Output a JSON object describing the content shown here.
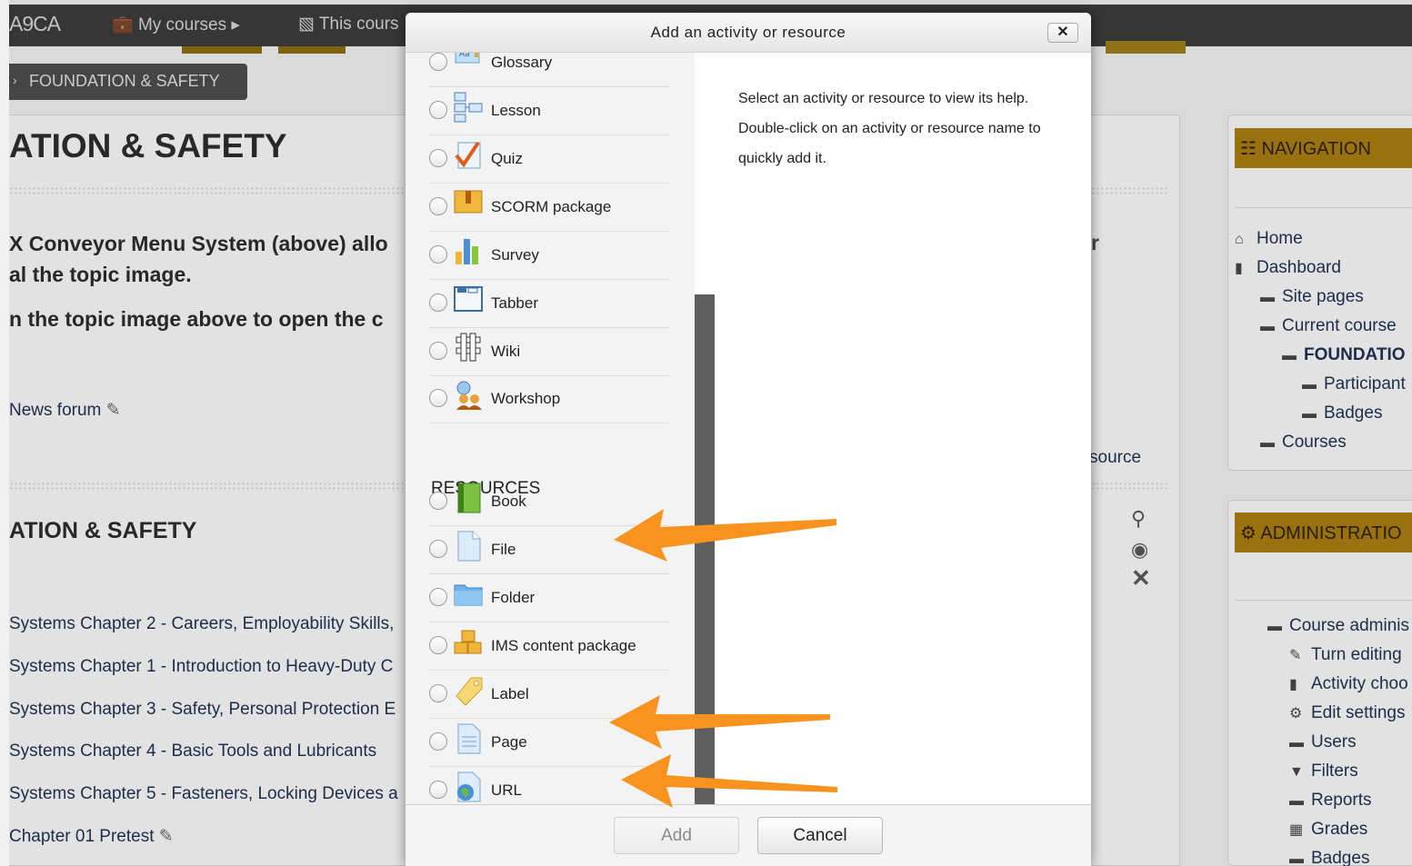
{
  "topbar": {
    "brand": "A9CA",
    "my_courses": "My courses",
    "this_course": "This cours"
  },
  "breadcrumb": {
    "label": "FOUNDATION & SAFETY"
  },
  "background": {
    "title1": "ATION & SAFETY",
    "para1": "X Conveyor Menu System (above) allo",
    "para2": "al the topic image.",
    "para3": "n the topic image above to open the c",
    "news_forum": "News forum",
    "stray_r": "r",
    "source_text": "source",
    "title2": "ATION & SAFETY",
    "links": [
      "Systems Chapter 2 - Careers, Employability Skills,",
      "Systems Chapter 1 - Introduction to Heavy-Duty C",
      "Systems Chapter 3 - Safety, Personal Protection E",
      "Systems Chapter 4 - Basic Tools and Lubricants",
      "Systems Chapter 5 - Fasteners, Locking Devices a",
      "Chapter 01 Pretest"
    ]
  },
  "navigation_block": {
    "title": "NAVIGATION",
    "items": [
      {
        "label": "Home",
        "icon": "home-icon"
      },
      {
        "label": "Dashboard",
        "icon": "file-icon"
      },
      {
        "label": "Site pages",
        "icon": "folder-icon"
      },
      {
        "label": "Current course",
        "icon": "folder-open-icon"
      },
      {
        "label": "FOUNDATIO",
        "icon": "folder-open-icon"
      },
      {
        "label": "Participant",
        "icon": "folder-icon"
      },
      {
        "label": "Badges",
        "icon": "folder-icon"
      },
      {
        "label": "Courses",
        "icon": "folder-icon"
      }
    ]
  },
  "administration_block": {
    "title": "ADMINISTRATIO",
    "items": [
      {
        "label": "Course adminis",
        "icon": "folder-open-icon"
      },
      {
        "label": "Turn editing",
        "icon": "pencil-icon"
      },
      {
        "label": "Activity choo",
        "icon": "file-icon"
      },
      {
        "label": "Edit settings",
        "icon": "gears-icon"
      },
      {
        "label": "Users",
        "icon": "folder-icon"
      },
      {
        "label": "Filters",
        "icon": "filter-icon"
      },
      {
        "label": "Reports",
        "icon": "folder-icon"
      },
      {
        "label": "Grades",
        "icon": "table-icon"
      },
      {
        "label": "Badges",
        "icon": "folder-icon"
      }
    ]
  },
  "dialog": {
    "title": "Add an activity or resource",
    "close": "✕",
    "activities": [
      {
        "label": "Glossary",
        "icon": "glossary-icon"
      },
      {
        "label": "Lesson",
        "icon": "lesson-icon"
      },
      {
        "label": "Quiz",
        "icon": "quiz-icon"
      },
      {
        "label": "SCORM package",
        "icon": "scorm-icon"
      },
      {
        "label": "Survey",
        "icon": "survey-icon"
      },
      {
        "label": "Tabber",
        "icon": "tabber-icon"
      },
      {
        "label": "Wiki",
        "icon": "wiki-icon"
      },
      {
        "label": "Workshop",
        "icon": "workshop-icon"
      }
    ],
    "resources_heading": "RESOURCES",
    "resources": [
      {
        "label": "Book",
        "icon": "book-icon"
      },
      {
        "label": "File",
        "icon": "file-icon"
      },
      {
        "label": "Folder",
        "icon": "folder-icon"
      },
      {
        "label": "IMS content package",
        "icon": "ims-package-icon"
      },
      {
        "label": "Label",
        "icon": "label-icon"
      },
      {
        "label": "Page",
        "icon": "page-icon"
      },
      {
        "label": "URL",
        "icon": "url-icon"
      }
    ],
    "help_text": "Select an activity or resource to view its help. Double-click on an activity or resource name to quickly add it.",
    "add_button": "Add",
    "cancel_button": "Cancel"
  },
  "colors": {
    "topbar": "#3a3a3a",
    "block_header": "#a37a10",
    "annotation_arrow": "#f7931e",
    "scroll_thumb": "#5e5e5e"
  }
}
